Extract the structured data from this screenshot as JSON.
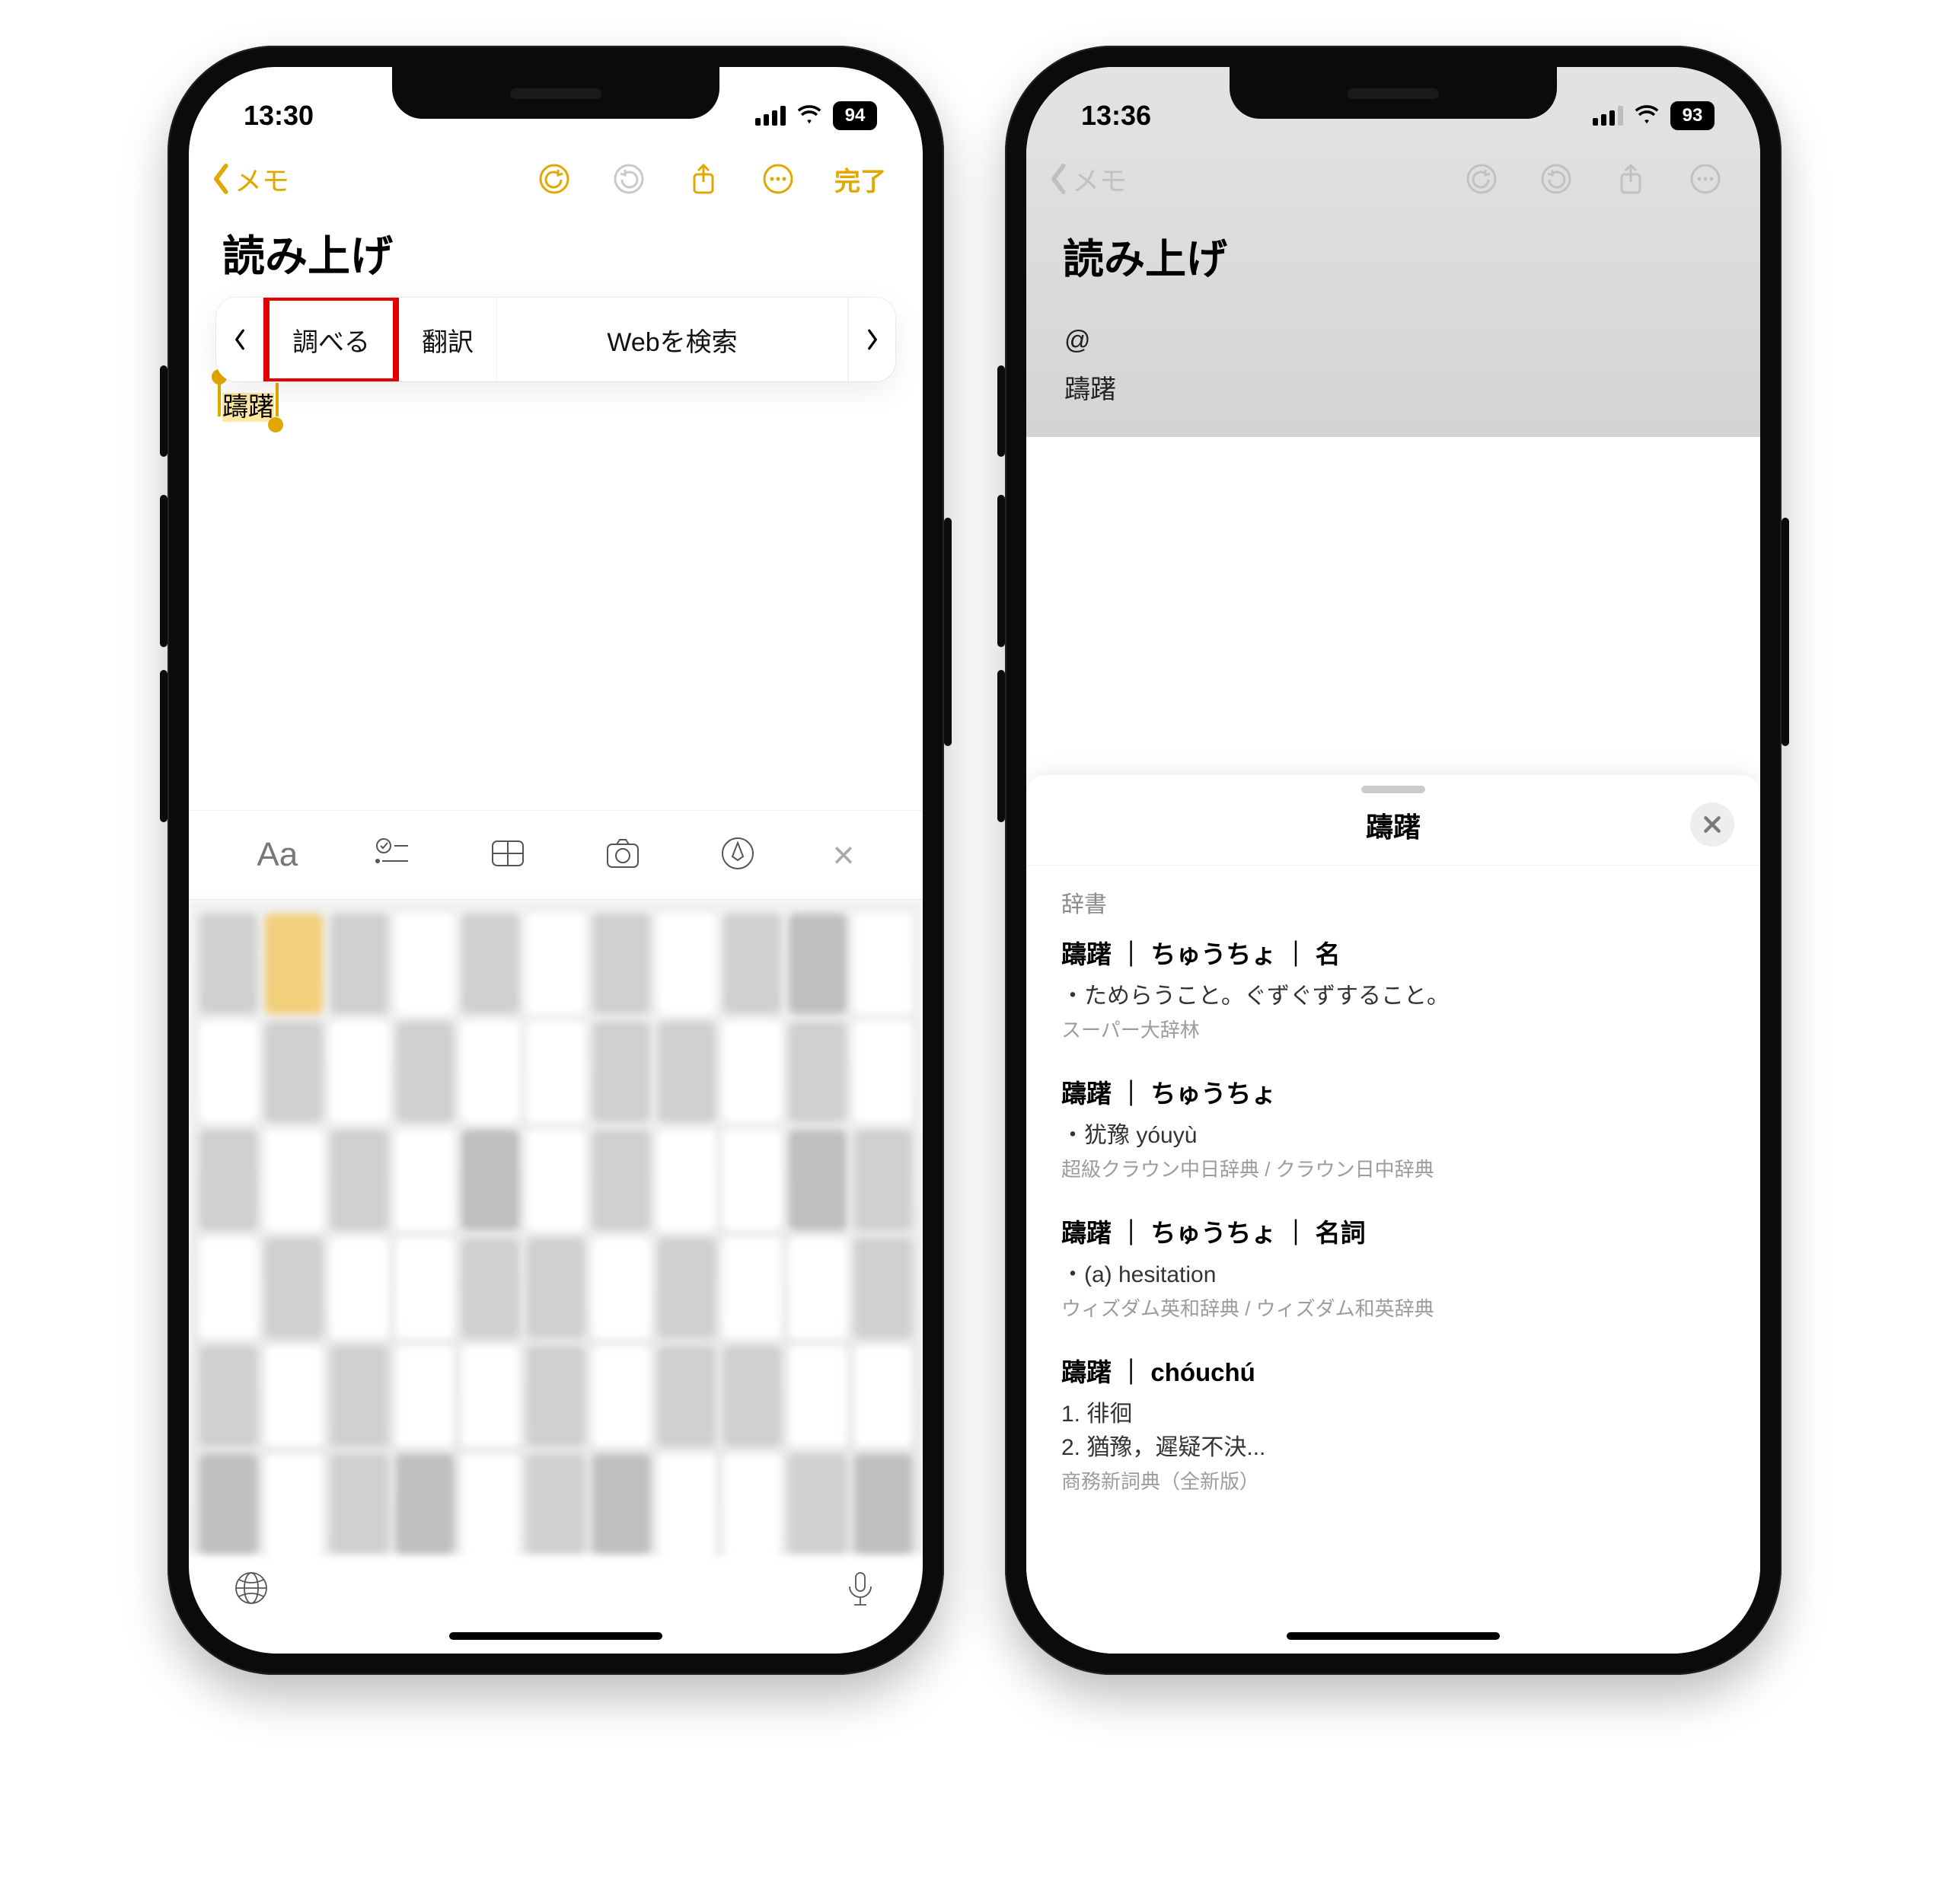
{
  "left": {
    "status": {
      "time": "13:30",
      "battery": "94"
    },
    "nav": {
      "back_label": "メモ",
      "done": "完了"
    },
    "title": "読み上げ",
    "popup": {
      "lookup": "調べる",
      "translate": "翻訳",
      "web": "Webを検索"
    },
    "selected_word": "躊躇"
  },
  "right": {
    "status": {
      "time": "13:36",
      "battery": "93"
    },
    "nav": {
      "back_label": "メモ"
    },
    "title": "読み上げ",
    "body_line1": "@",
    "body_line2": "躊躇",
    "sheet": {
      "word": "躊躇",
      "section": "辞書",
      "entries": [
        {
          "head": "躊躇 ｜ ちゅうちょ ｜ 名",
          "body": "・ためらうこと。ぐずぐずすること。",
          "source": "スーパー大辞林"
        },
        {
          "head": "躊躇 ｜ ちゅうちょ",
          "body": "・犹豫 yóuyù",
          "source": "超級クラウン中日辞典 / クラウン日中辞典"
        },
        {
          "head": "躊躇 ｜ ちゅうちょ ｜ 名詞",
          "body": "・(a)  hesitation",
          "source": "ウィズダム英和辞典 / ウィズダム和英辞典"
        },
        {
          "head": "躊躇 ｜ chóuchú",
          "body": "1. 徘徊\n2. 猶豫，遲疑不決...",
          "source": "商務新詞典（全新版）"
        }
      ]
    }
  }
}
